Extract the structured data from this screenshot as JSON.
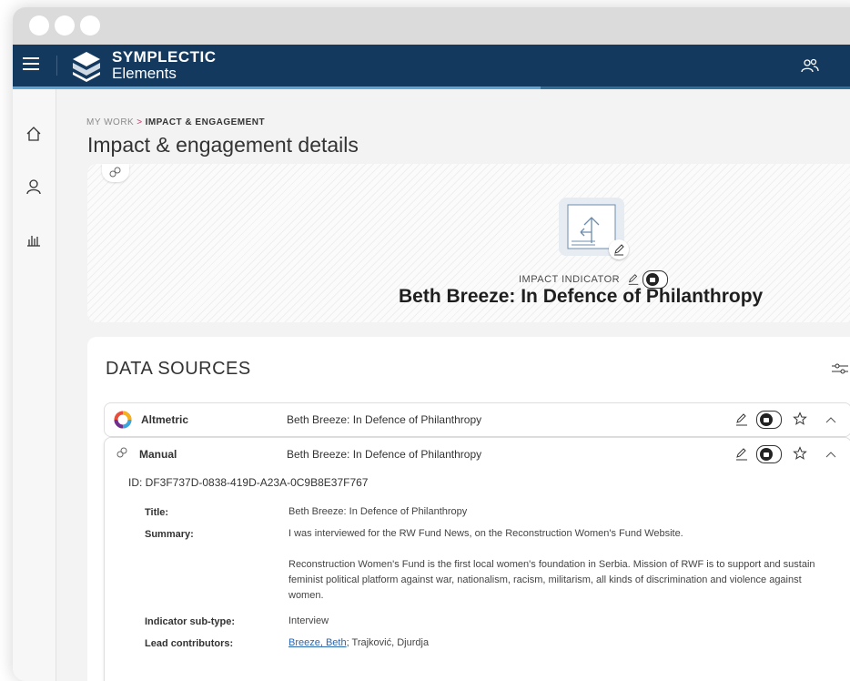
{
  "app": {
    "brand_top": "SYMPLECTIC",
    "brand_bottom": "Elements"
  },
  "breadcrumb": {
    "parent": "MY WORK",
    "separator": ">",
    "current": "IMPACT & ENGAGEMENT"
  },
  "page_title": "Impact & engagement details",
  "hero": {
    "type_label": "IMPACT INDICATOR",
    "title": "Beth Breeze: In Defence of Philanthropy"
  },
  "data_sources": {
    "heading": "DATA SOURCES",
    "rows": [
      {
        "source": "Altmetric",
        "title": "Beth Breeze: In Defence of Philanthropy"
      },
      {
        "source": "Manual",
        "title": "Beth Breeze: In Defence of Philanthropy"
      }
    ],
    "details": {
      "id": "ID: DF3F737D-0838-419D-A23A-0C9B8E37F767",
      "title_label": "Title:",
      "title_value": "Beth Breeze: In Defence of Philanthropy",
      "summary_label": "Summary:",
      "summary_p1": "I was interviewed for the RW Fund News, on the Reconstruction Women's Fund Website.",
      "summary_p2": "Reconstruction Women's Fund is the first local women's foundation in Serbia. Mission of RWF is to support and sustain feminist political platform against war, nationalism, racism, militarism, all kinds of discrimination and violence against women.",
      "subtype_label": "Indicator sub-type:",
      "subtype_value": "Interview",
      "contributors_label": "Lead contributors:",
      "contributor_link": "Breeze, Beth",
      "contributor_rest": "; Trajković, Djurdja"
    }
  },
  "colors": {
    "topbar": "#14395f",
    "accent": "#c8366b",
    "link": "#2b66b0"
  },
  "icons": [
    "menu-icon",
    "symplectic-logo",
    "users-icon",
    "home-icon",
    "person-icon",
    "chart-icon",
    "link-icon",
    "edit-icon",
    "lock-icon",
    "star-icon",
    "chevron-up-icon",
    "filter-icon",
    "altmetric-icon"
  ]
}
